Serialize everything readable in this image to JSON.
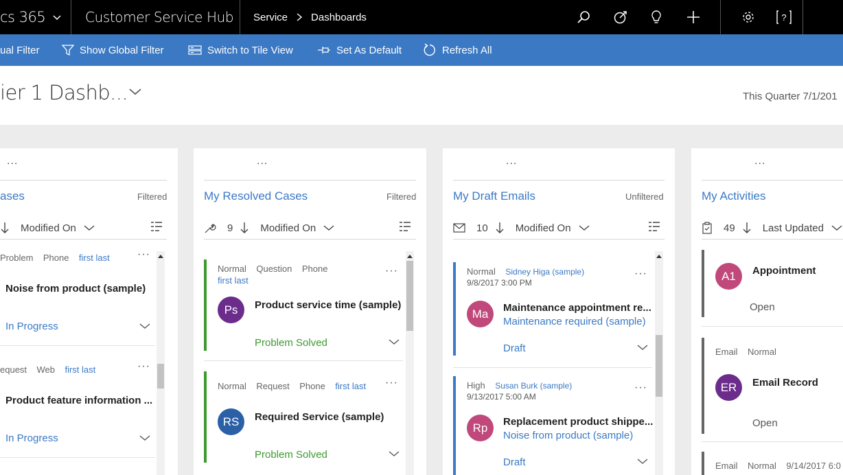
{
  "colors": {
    "topnav_bg": "#000000",
    "cmdbar_bg": "#3b79c4",
    "link": "#3b79c4",
    "resolved_green": "#3d9a2f",
    "draft_blue": "#3b79c4",
    "activity_gray": "#666666"
  },
  "topnav": {
    "app_title": "cs 365",
    "hub_title": "Customer Service Hub",
    "breadcrumb": [
      "Service",
      "Dashboards"
    ],
    "icons": [
      "search-icon",
      "target-icon",
      "lightbulb-icon",
      "plus-icon",
      "gear-icon",
      "help-icon"
    ]
  },
  "commandbar": {
    "visual_filter": "ual Filter",
    "global_filter": "Show Global Filter",
    "tile_view": "Switch to Tile View",
    "set_default": "Set As Default",
    "refresh_all": "Refresh All"
  },
  "dashboard": {
    "title": "ier 1 Dashb...",
    "period": "This Quarter 7/1/201"
  },
  "streams": [
    {
      "title": "ases",
      "filter": "Filtered",
      "more": "...",
      "sort_field": "Modified On",
      "cards": [
        {
          "meta": [
            "Problem",
            "Phone"
          ],
          "owner": "first last",
          "title": "Noise from product (sample)",
          "status": "In Progress"
        },
        {
          "meta": [
            "equest",
            "Web"
          ],
          "owner": "first last",
          "title": "Product feature information ...",
          "status": "In Progress"
        }
      ]
    },
    {
      "title": "My Resolved Cases",
      "filter": "Filtered",
      "more": "...",
      "count": "9",
      "sort_field": "Modified On",
      "cards": [
        {
          "meta": [
            "Normal",
            "Question",
            "Phone"
          ],
          "owner": "first last",
          "initials": "Ps",
          "avatar_color": "#6b2c8b",
          "title": "Product service time (sample)",
          "status": "Problem Solved"
        },
        {
          "meta": [
            "Normal",
            "Request",
            "Phone"
          ],
          "owner": "first last",
          "initials": "RS",
          "avatar_color": "#2b5fa6",
          "title": "Required Service (sample)",
          "status": "Problem Solved"
        }
      ]
    },
    {
      "title": "My Draft Emails",
      "filter": "Unfiltered",
      "more": "...",
      "count": "10",
      "sort_field": "Modified On",
      "cards": [
        {
          "priority": "Normal",
          "contact": "Sidney Higa (sample)",
          "date": "9/8/2017 3:00 PM",
          "initials": "Ma",
          "avatar_color": "#c0487a",
          "title": "Maintenance appointment re...",
          "regarding": "Maintenance required (sample)",
          "status": "Draft"
        },
        {
          "priority": "High",
          "contact": "Susan Burk (sample)",
          "date": "9/13/2017 5:00 AM",
          "initials": "Rp",
          "avatar_color": "#c0487a",
          "title": "Replacement product shippe...",
          "regarding": "Noise from product (sample)",
          "status": "Draft"
        }
      ]
    },
    {
      "title": "My Activities",
      "more": "...",
      "count": "49",
      "sort_field": "Last Updated",
      "cards": [
        {
          "initials": "A1",
          "avatar_color": "#c0487a",
          "title": "Appointment",
          "status": "Open"
        },
        {
          "meta": [
            "Email",
            "Normal"
          ],
          "initials": "ER",
          "avatar_color": "#6b2c8b",
          "title": "Email Record",
          "status": "Open"
        },
        {
          "meta": [
            "Email",
            "Normal"
          ],
          "date": "9/14/2017 6:0"
        }
      ]
    }
  ]
}
